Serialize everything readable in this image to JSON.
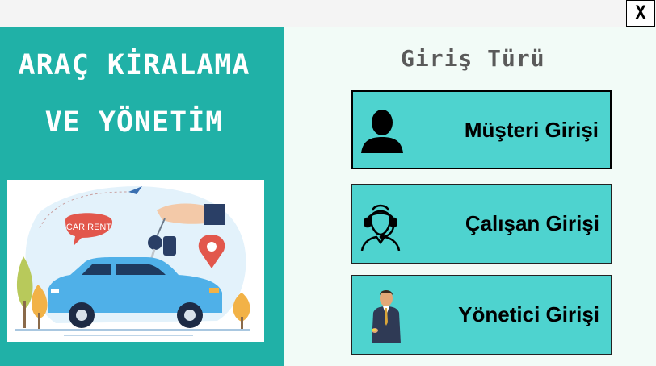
{
  "window": {
    "close_label": "X"
  },
  "left_panel": {
    "title": "ARAÇ KİRALAMA\nVE YÖNETİM",
    "illustration_text": "CAR RENT"
  },
  "right_panel": {
    "section_title": "Giriş Türü",
    "buttons": [
      {
        "label": "Müşteri Girişi",
        "icon": "user-icon"
      },
      {
        "label": "Çalışan Girişi",
        "icon": "headset-agent-icon"
      },
      {
        "label": "Yönetici Girişi",
        "icon": "businessman-icon"
      }
    ]
  },
  "colors": {
    "left_panel_bg": "#20b1a7",
    "right_panel_bg": "#f2fbf7",
    "button_bg": "#4ed3cf"
  }
}
